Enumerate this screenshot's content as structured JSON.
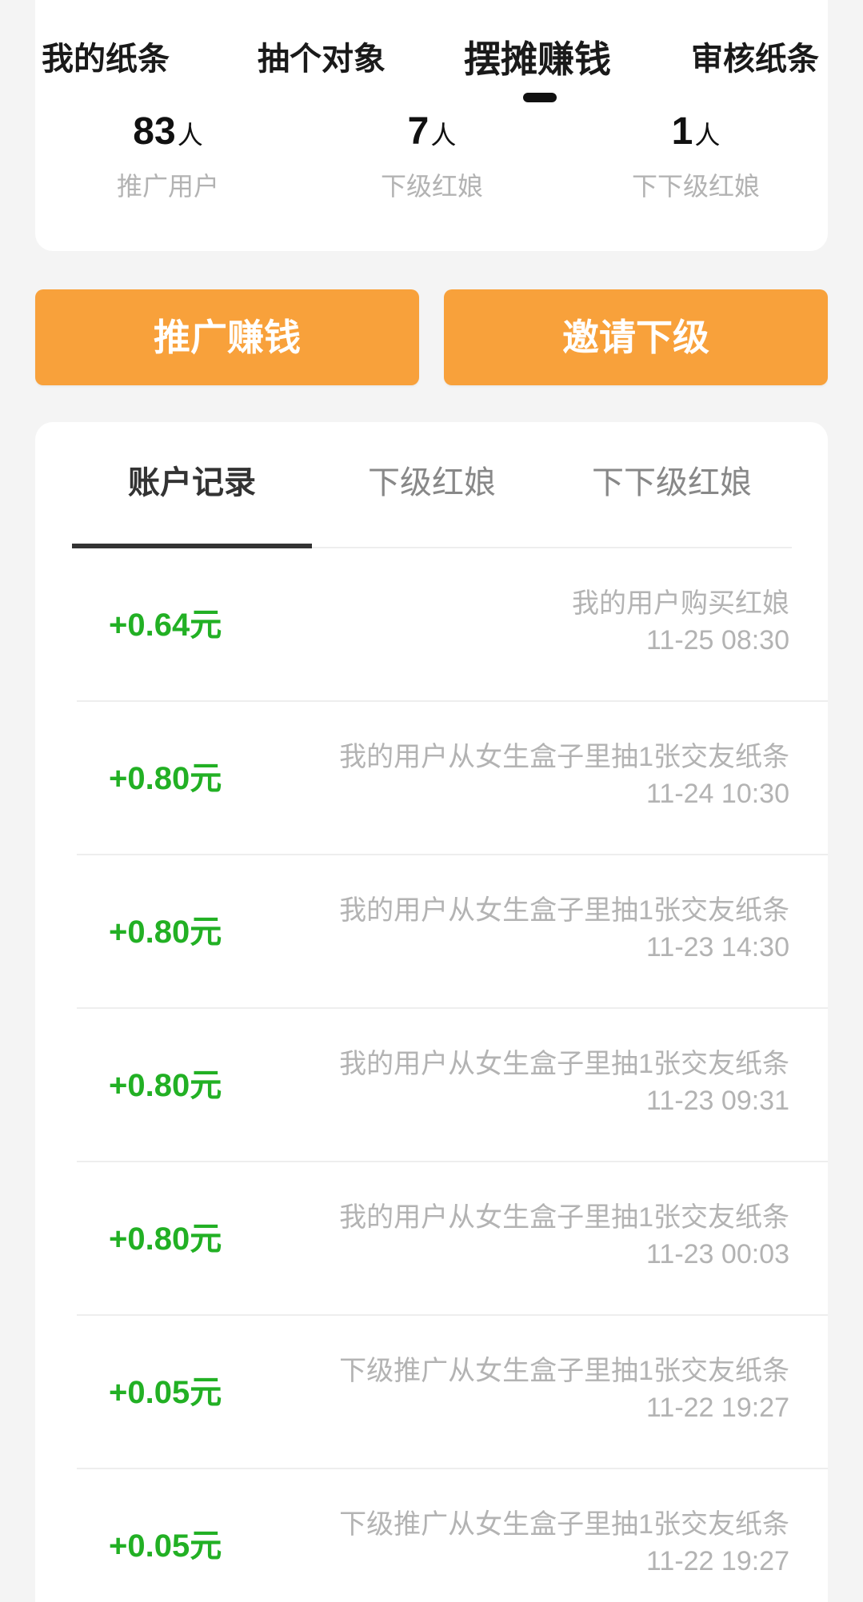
{
  "top_tabs": [
    {
      "label": "我的纸条",
      "active": false
    },
    {
      "label": "抽个对象",
      "active": false
    },
    {
      "label": "摆摊赚钱",
      "active": true
    },
    {
      "label": "审核纸条",
      "active": false
    }
  ],
  "stats": [
    {
      "value": "83",
      "unit": "人",
      "label": "推广用户"
    },
    {
      "value": "7",
      "unit": "人",
      "label": "下级红娘"
    },
    {
      "value": "1",
      "unit": "人",
      "label": "下下级红娘"
    }
  ],
  "buttons": {
    "promote": "推广赚钱",
    "invite": "邀请下级"
  },
  "record_tabs": [
    {
      "label": "账户记录",
      "active": true
    },
    {
      "label": "下级红娘",
      "active": false
    },
    {
      "label": "下下级红娘",
      "active": false
    }
  ],
  "records": [
    {
      "amount": "+0.64元",
      "desc": "我的用户购买红娘",
      "time": "11-25 08:30"
    },
    {
      "amount": "+0.80元",
      "desc": "我的用户从女生盒子里抽1张交友纸条",
      "time": "11-24 10:30"
    },
    {
      "amount": "+0.80元",
      "desc": "我的用户从女生盒子里抽1张交友纸条",
      "time": "11-23 14:30"
    },
    {
      "amount": "+0.80元",
      "desc": "我的用户从女生盒子里抽1张交友纸条",
      "time": "11-23 09:31"
    },
    {
      "amount": "+0.80元",
      "desc": "我的用户从女生盒子里抽1张交友纸条",
      "time": "11-23 00:03"
    },
    {
      "amount": "+0.05元",
      "desc": "下级推广从女生盒子里抽1张交友纸条",
      "time": "11-22 19:27"
    },
    {
      "amount": "+0.05元",
      "desc": "下级推广从女生盒子里抽1张交友纸条",
      "time": "11-22 19:27"
    }
  ],
  "colors": {
    "accent_orange": "#f8a13b",
    "amount_green": "#22b024",
    "muted_text": "#b3b3b3"
  }
}
